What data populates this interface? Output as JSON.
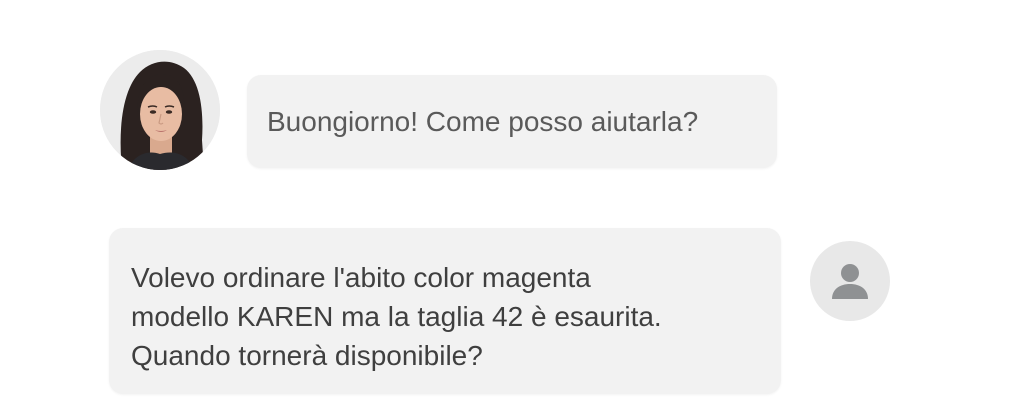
{
  "conversation": {
    "messages": [
      {
        "sender": "agent",
        "avatar": "agent-photo-avatar",
        "text": "Buongiorno! Come posso aiutarla?"
      },
      {
        "sender": "user",
        "avatar": "user-placeholder-icon",
        "lines": [
          "Volevo ordinare l'abito color magenta",
          "modello KAREN ma la taglia 42 è esaurita.",
          "Quando tornerà disponibile?"
        ]
      }
    ]
  },
  "colors": {
    "bubble_background": "#f2f2f2",
    "agent_text": "#5a5a5a",
    "user_text": "#3f3f3f",
    "user_icon": "#8f9193"
  }
}
